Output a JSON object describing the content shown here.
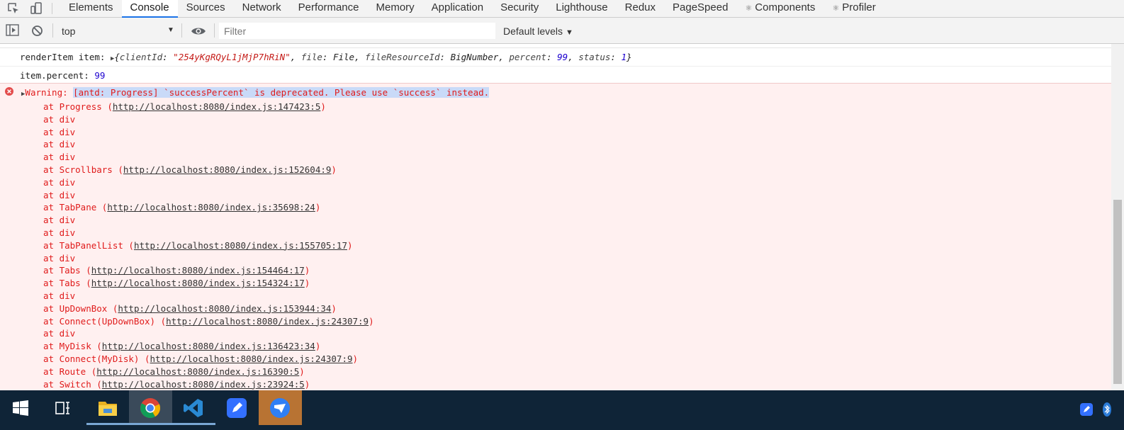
{
  "devtools": {
    "tabs": [
      "Elements",
      "Console",
      "Sources",
      "Network",
      "Performance",
      "Memory",
      "Application",
      "Security",
      "Lighthouse",
      "Redux",
      "PageSpeed",
      "Components",
      "Profiler"
    ],
    "gear_tabs": [
      "Components",
      "Profiler"
    ],
    "active_tab": "Console"
  },
  "toolbar": {
    "context": "top",
    "filter_placeholder": "Filter",
    "levels_label": "Default levels"
  },
  "console": {
    "log1": {
      "label": "renderItem item: ",
      "open_brace": "{",
      "close_brace": "}",
      "fields": [
        {
          "key": "clientId",
          "value": "\"254yKgRQyL1jMjP7hRiN\"",
          "kind": "str"
        },
        {
          "key": "file",
          "value": "File",
          "kind": "obj"
        },
        {
          "key": "fileResourceId",
          "value": "BigNumber",
          "kind": "obj"
        },
        {
          "key": "percent",
          "value": "99",
          "kind": "num"
        },
        {
          "key": "status",
          "value": "1",
          "kind": "num"
        }
      ]
    },
    "log2": {
      "label": "item.percent: ",
      "value": "99"
    },
    "error": {
      "prefix": "Warning: ",
      "message": "[antd: Progress] `successPercent` is deprecated. Please use `success` instead.",
      "stack": [
        {
          "fn": "Progress",
          "url": "http://localhost:8080/index.js:147423:5"
        },
        {
          "fn": "div"
        },
        {
          "fn": "div"
        },
        {
          "fn": "div"
        },
        {
          "fn": "div"
        },
        {
          "fn": "Scrollbars",
          "url": "http://localhost:8080/index.js:152604:9"
        },
        {
          "fn": "div"
        },
        {
          "fn": "div"
        },
        {
          "fn": "TabPane",
          "url": "http://localhost:8080/index.js:35698:24"
        },
        {
          "fn": "div"
        },
        {
          "fn": "div"
        },
        {
          "fn": "TabPanelList",
          "url": "http://localhost:8080/index.js:155705:17"
        },
        {
          "fn": "div"
        },
        {
          "fn": "Tabs",
          "url": "http://localhost:8080/index.js:154464:17"
        },
        {
          "fn": "Tabs",
          "url": "http://localhost:8080/index.js:154324:17"
        },
        {
          "fn": "div"
        },
        {
          "fn": "UpDownBox",
          "url": "http://localhost:8080/index.js:153944:34"
        },
        {
          "fn": "Connect(UpDownBox)",
          "url": "http://localhost:8080/index.js:24307:9"
        },
        {
          "fn": "div"
        },
        {
          "fn": "MyDisk",
          "url": "http://localhost:8080/index.js:136423:34"
        },
        {
          "fn": "Connect(MyDisk)",
          "url": "http://localhost:8080/index.js:24307:9"
        },
        {
          "fn": "Route",
          "url": "http://localhost:8080/index.js:16390:5"
        },
        {
          "fn": "Switch",
          "url": "http://localhost:8080/index.js:23924:5"
        }
      ]
    }
  },
  "taskbar": {
    "items": [
      {
        "name": "start-icon"
      },
      {
        "name": "task-view-icon"
      },
      {
        "name": "file-explorer-icon"
      },
      {
        "name": "chrome-icon"
      },
      {
        "name": "vscode-icon"
      },
      {
        "name": "feishu-doc-icon"
      },
      {
        "name": "feishu-icon"
      }
    ]
  }
}
